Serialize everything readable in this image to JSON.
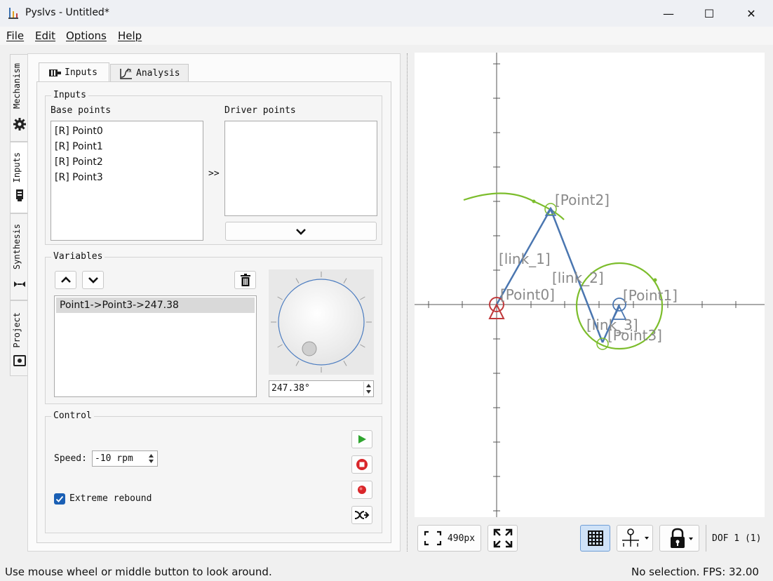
{
  "window": {
    "title": "Pyslvs - Untitled*",
    "minimize": "—",
    "maximize": "☐",
    "close": "✕"
  },
  "menu": {
    "file": "File",
    "edit": "Edit",
    "options": "Options",
    "help": "Help"
  },
  "side_tabs": {
    "mechanism": "Mechanism",
    "inputs": "Inputs",
    "synthesis": "Synthesis",
    "project": "Project",
    "active": "inputs"
  },
  "top_tabs": {
    "inputs": "Inputs",
    "analysis": "Analysis",
    "active": "inputs"
  },
  "inputs_group": {
    "title": "Inputs",
    "base_points_label": "Base points",
    "driver_points_label": "Driver points",
    "base_points": [
      "[R] Point0",
      "[R] Point1",
      "[R] Point2",
      "[R] Point3"
    ],
    "driver_points": [],
    "add_arrow": ">>"
  },
  "variables_group": {
    "title": "Variables",
    "items": [
      "Point1->Point3->247.38"
    ],
    "dial_value": "247.38°",
    "dial_angle_deg": 247.38
  },
  "control_group": {
    "title": "Control",
    "speed_label": "Speed:",
    "speed_value": "-10 rpm",
    "extreme_rebound_label": "Extreme rebound",
    "extreme_rebound_checked": true
  },
  "canvas": {
    "labels": {
      "point0": "[Point0]",
      "point1": "[Point1]",
      "point2": "[Point2]",
      "point3": "[Point3]",
      "link1": "[link_1]",
      "link2": "[link_2]",
      "link3": "[link_3]"
    },
    "colors": {
      "link": "#4a76b0",
      "curve": "#7cbd2c",
      "ground": "#c0393b",
      "label": "#8a8a8a",
      "axis": "#555555"
    }
  },
  "canvas_toolbar": {
    "zoom_value": "490px",
    "dof_label": "DOF 1 (1)"
  },
  "status": {
    "hint": "Use mouse wheel or middle button to look around.",
    "selection": "No selection.",
    "fps": "FPS: 32.00"
  }
}
